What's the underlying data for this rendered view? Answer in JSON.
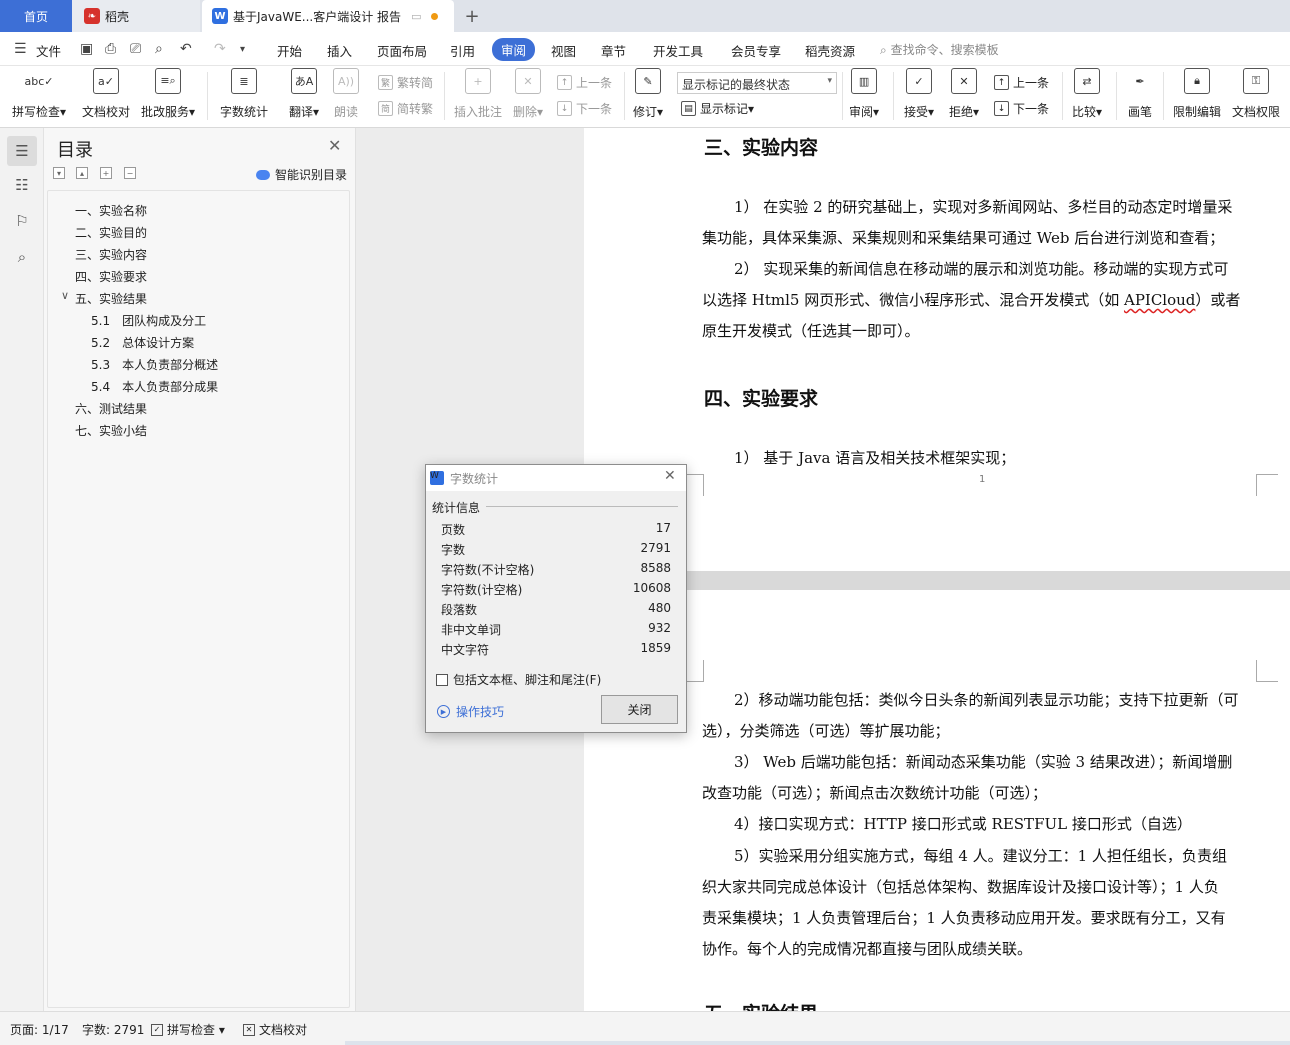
{
  "tabs": {
    "home": "首页",
    "daoke": "稻壳",
    "doc": "基于JavaWE...客户端设计 报告",
    "add": "+"
  },
  "menubar": {
    "file": "文件",
    "items": [
      "开始",
      "插入",
      "页面布局",
      "引用",
      "审阅",
      "视图",
      "章节",
      "开发工具",
      "会员专享",
      "稻壳资源"
    ],
    "active": "审阅",
    "search": "查找命令、搜索模板"
  },
  "ribbon": {
    "spellcheck": "拼写检查",
    "doc_check": "文档校对",
    "batch_service": "批改服务",
    "word_count": "字数统计",
    "translate": "翻译",
    "read_aloud": "朗读",
    "to_traditional": "繁转简",
    "to_simplified": "简转繁",
    "insert_comment": "插入批注",
    "delete": "删除",
    "prev_comment": "上一条",
    "next_comment": "下一条",
    "track_changes": "修订",
    "markup_state": "显示标记的最终状态",
    "show_markup": "显示标记",
    "review": "审阅",
    "accept": "接受",
    "reject": "拒绝",
    "prev_change": "上一条",
    "next_change": "下一条",
    "compare": "比较",
    "pen": "画笔",
    "restrict_edit": "限制编辑",
    "doc_permission": "文档权限"
  },
  "toc": {
    "title": "目录",
    "smart": "智能识别目录",
    "items": [
      {
        "label": "一、实验名称",
        "level": 1
      },
      {
        "label": "二、实验目的",
        "level": 1
      },
      {
        "label": "三、实验内容",
        "level": 1
      },
      {
        "label": "四、实验要求",
        "level": 1
      },
      {
        "label": "五、实验结果",
        "level": 1,
        "expanded": true
      },
      {
        "label": "5.1　团队构成及分工",
        "level": 2
      },
      {
        "label": "5.2　总体设计方案",
        "level": 2
      },
      {
        "label": "5.3　本人负责部分概述",
        "level": 2
      },
      {
        "label": "5.4　本人负责部分成果",
        "level": 2
      },
      {
        "label": "六、测试结果",
        "level": 1
      },
      {
        "label": "七、实验小结",
        "level": 1
      }
    ]
  },
  "document": {
    "h3": "三、实验内容",
    "p1_l1": "1）  在实验 2 的研究基础上，实现对多新闻网站、多栏目的动态定时增量采",
    "p1_l2": "集功能，具体采集源、采集规则和采集结果可通过 Web 后台进行浏览和查看；",
    "p2_l1": "2）  实现采集的新闻信息在移动端的展示和浏览功能。移动端的实现方式可",
    "p2_l2a": "以选择 Html5 网页形式、微信小程序形式、混合开发模式（如 ",
    "p2_l2b": "APICloud",
    "p2_l2c": "）或者",
    "p2_l3": "原生开发模式（任选其一即可）。",
    "h4": "四、实验要求",
    "req1": "1）  基于 Java 语言及相关技术框架实现；",
    "page_number": "1",
    "req2_l1": "2）移动端功能包括：类似今日头条的新闻列表显示功能；支持下拉更新（可",
    "req2_l2": "选），分类筛选（可选）等扩展功能；",
    "req3_l1": "3）  Web 后端功能包括：新闻动态采集功能（实验 3 结果改进）；新闻增删",
    "req3_l2": "改查功能（可选）；新闻点击次数统计功能（可选）；",
    "req4": "4）接口实现方式：HTTP 接口形式或 RESTFUL 接口形式（自选）",
    "req5_l1": "5）实验采用分组实施方式，每组 4 人。建议分工：1 人担任组长，负责组",
    "req5_l2": "织大家共同完成总体设计（包括总体架构、数据库设计及接口设计等）；1 人负",
    "req5_l3": "责采集模块；1 人负责管理后台；1 人负责移动应用开发。要求既有分工，又有",
    "req5_l4": "协作。每个人的完成情况都直接与团队成绩关联。",
    "h5_partial": "五、实验结果"
  },
  "dialog": {
    "title": "字数统计",
    "section": "统计信息",
    "stats": [
      {
        "label": "页数",
        "value": "17"
      },
      {
        "label": "字数",
        "value": "2791"
      },
      {
        "label": "字符数(不计空格)",
        "value": "8588"
      },
      {
        "label": "字符数(计空格)",
        "value": "10608"
      },
      {
        "label": "段落数",
        "value": "480"
      },
      {
        "label": "非中文单词",
        "value": "932"
      },
      {
        "label": "中文字符",
        "value": "1859"
      }
    ],
    "include_label": "包括文本框、脚注和尾注(F)",
    "tips": "操作技巧",
    "close": "关闭"
  },
  "status": {
    "page": "页面: 1/17",
    "words": "字数: 2791",
    "spellcheck": "拼写检查",
    "doc_check": "文档校对"
  }
}
